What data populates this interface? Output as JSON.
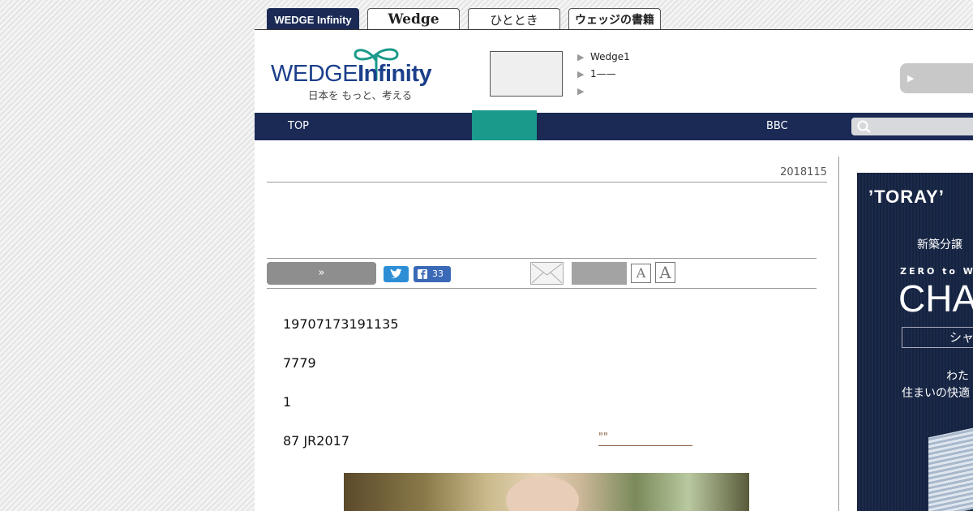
{
  "brand_tabs": [
    {
      "label": "WEDGE Infinity",
      "active": true
    },
    {
      "label": "Wedge",
      "active": false
    },
    {
      "label": "ひととき",
      "active": false
    },
    {
      "label": "ウェッジの書籍",
      "active": false
    }
  ],
  "logo": {
    "name_main": "WEDGE",
    "name_accent": "Infinity",
    "tagline": "日本を もっと、考える"
  },
  "header_links": [
    "Wedge1",
    "1——",
    ""
  ],
  "nav": {
    "items": [
      "TOP",
      "BBC"
    ],
    "search_placeholder": ""
  },
  "article": {
    "date": "2018115",
    "share": {
      "more_label": "»",
      "facebook_count": "33"
    },
    "font_size_labels": [
      "A",
      "A"
    ],
    "paragraphs": [
      "19707173191135",
      "7779",
      "1",
      "87 JR2017"
    ],
    "link_quote": "\"\""
  },
  "ad": {
    "brand": "ʼTORAYʼ",
    "line1": "新築分譲",
    "zero_to": "ZERO to W",
    "headline": "CHA",
    "box_text": "シャ",
    "line2": "わた",
    "line3": "住まいの快適"
  },
  "colors": {
    "navy": "#1b2a55",
    "teal": "#1a9a8a",
    "twitter": "#2d8ed6",
    "facebook": "#3a6ab7",
    "logo_blue": "#1b3f8b"
  }
}
